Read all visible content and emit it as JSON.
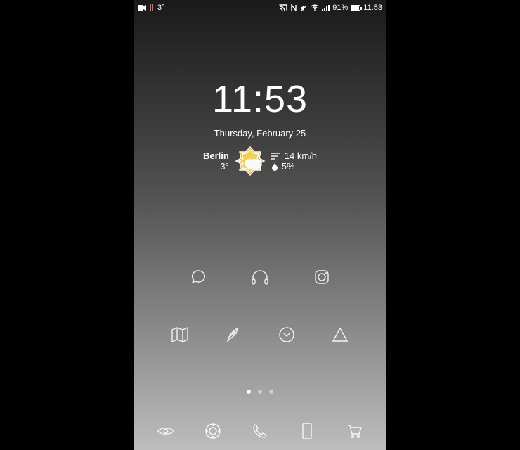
{
  "statusbar": {
    "temp": "3°",
    "battery_pct": "91%",
    "time": "11:53"
  },
  "widget": {
    "clock": "11:53",
    "date": "Thursday, February 25",
    "city": "Berlin",
    "temp": "3°",
    "wind": "14 km/h",
    "humidity": "5%"
  },
  "apps_row_a": [
    {
      "name": "chat-icon"
    },
    {
      "name": "headphones-icon"
    },
    {
      "name": "camera-icon"
    }
  ],
  "apps_row_b": [
    {
      "name": "map-icon"
    },
    {
      "name": "feather-icon"
    },
    {
      "name": "clock-icon"
    },
    {
      "name": "triangle-icon"
    }
  ],
  "dock": [
    {
      "name": "eye-icon"
    },
    {
      "name": "compass-icon"
    },
    {
      "name": "phone-icon"
    },
    {
      "name": "device-icon"
    },
    {
      "name": "cart-icon"
    }
  ],
  "pages": {
    "count": 3,
    "active": 0
  }
}
